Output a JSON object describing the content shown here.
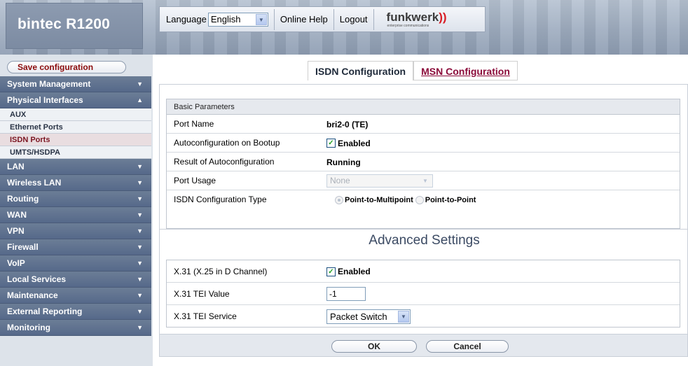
{
  "header": {
    "brand": "bintec R1200",
    "language_label": "Language",
    "language_value": "English",
    "online_help": "Online Help",
    "logout": "Logout",
    "vendor_logo": "funkwerk",
    "vendor_tagline": "enterprise communications"
  },
  "sidebar": {
    "save_label": "Save configuration",
    "items": [
      {
        "label": "System Management"
      },
      {
        "label": "Physical Interfaces"
      },
      {
        "label": "LAN"
      },
      {
        "label": "Wireless LAN"
      },
      {
        "label": "Routing"
      },
      {
        "label": "WAN"
      },
      {
        "label": "VPN"
      },
      {
        "label": "Firewall"
      },
      {
        "label": "VoIP"
      },
      {
        "label": "Local Services"
      },
      {
        "label": "Maintenance"
      },
      {
        "label": "External Reporting"
      },
      {
        "label": "Monitoring"
      }
    ],
    "sub_items": [
      {
        "label": "AUX"
      },
      {
        "label": "Ethernet Ports"
      },
      {
        "label": "ISDN Ports"
      },
      {
        "label": "UMTS/HSDPA"
      }
    ]
  },
  "tabs": [
    {
      "label": "ISDN Configuration"
    },
    {
      "label": "MSN Configuration"
    }
  ],
  "basic": {
    "title": "Basic Parameters",
    "port_name_label": "Port Name",
    "port_name_value": "bri2-0  (TE)",
    "autoconf_label": "Autoconfiguration on Bootup",
    "autoconf_value": "Enabled",
    "result_label": "Result of Autoconfiguration",
    "result_value": "Running",
    "usage_label": "Port Usage",
    "usage_value": "None",
    "type_label": "ISDN Configuration Type",
    "type_opt1": "Point-to-Multipoint",
    "type_opt2": "Point-to-Point"
  },
  "advanced": {
    "title": "Advanced Settings",
    "x31_label": "X.31 (X.25 in D Channel)",
    "x31_value": "Enabled",
    "tei_label": "X.31 TEI Value",
    "tei_value": "-1",
    "service_label": "X.31 TEI Service",
    "service_value": "Packet Switch"
  },
  "buttons": {
    "ok": "OK",
    "cancel": "Cancel"
  }
}
